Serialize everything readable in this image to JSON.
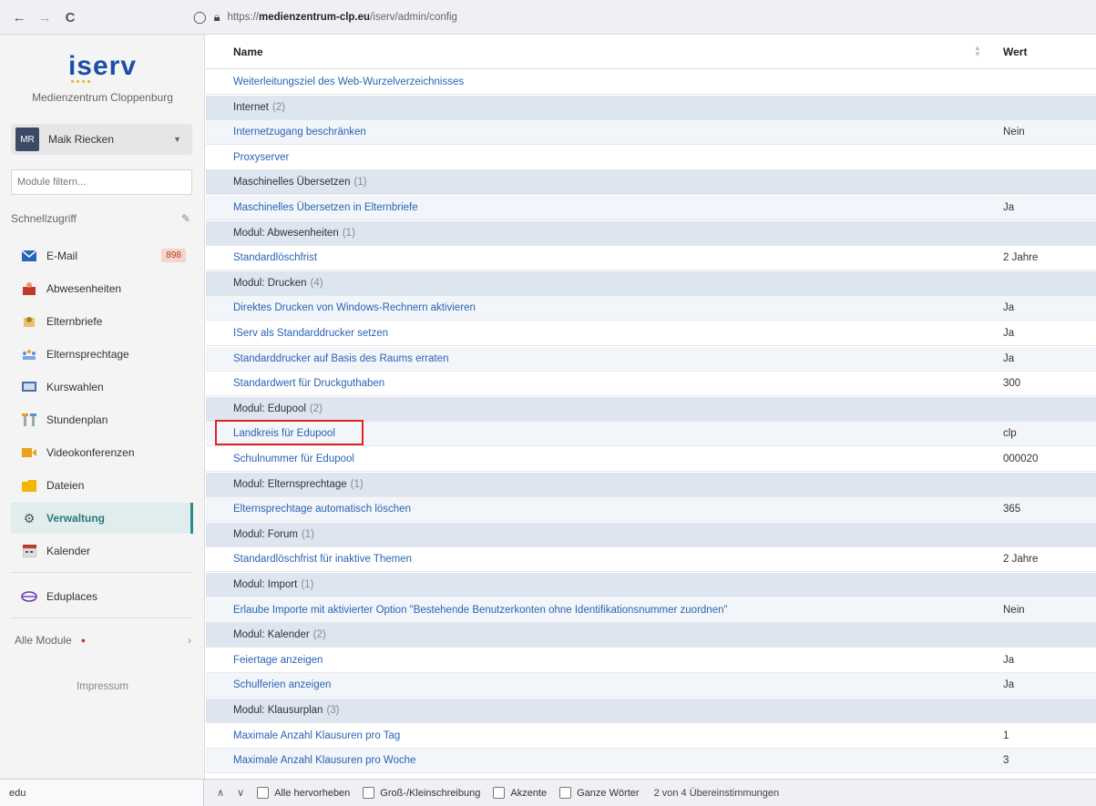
{
  "browser": {
    "back": "←",
    "forward": "→",
    "reload": "C",
    "url_prefix": "https://",
    "url_domain": "medienzentrum-clp.eu",
    "url_path": "/iserv/admin/config"
  },
  "sidebar": {
    "logo": "iserv",
    "school": "Medienzentrum Cloppenburg",
    "user": {
      "initials": "MR",
      "name": "Maik Riecken"
    },
    "filter_placeholder": "Module filtern...",
    "quick_access": "Schnellzugriff",
    "items": [
      {
        "label": "E-Mail",
        "badge": "898",
        "icon": "mail-icon"
      },
      {
        "label": "Abwesenheiten",
        "icon": "absence-icon"
      },
      {
        "label": "Elternbriefe",
        "icon": "letter-icon"
      },
      {
        "label": "Elternsprechtage",
        "icon": "people-icon"
      },
      {
        "label": "Kurswahlen",
        "icon": "course-icon"
      },
      {
        "label": "Stundenplan",
        "icon": "timetable-icon"
      },
      {
        "label": "Videokonferenzen",
        "icon": "video-icon"
      },
      {
        "label": "Dateien",
        "icon": "folder-icon"
      },
      {
        "label": "Verwaltung",
        "icon": "gear-icon",
        "active": true
      },
      {
        "label": "Kalender",
        "icon": "calendar-icon"
      }
    ],
    "eduplaces": "Eduplaces",
    "all_modules": "Alle Module",
    "impressum": "Impressum"
  },
  "table": {
    "header_name": "Name",
    "header_value": "Wert",
    "rows": [
      {
        "type": "item",
        "name": "Weiterleitungsziel des Web-Wurzelverzeichnisses",
        "value": ""
      },
      {
        "type": "group",
        "name": "Internet",
        "count": "(2)"
      },
      {
        "type": "item",
        "name": "Internetzugang beschränken",
        "value": "Nein"
      },
      {
        "type": "item",
        "name": "Proxyserver",
        "value": ""
      },
      {
        "type": "group",
        "name": "Maschinelles Übersetzen",
        "count": "(1)"
      },
      {
        "type": "item",
        "name": "Maschinelles Übersetzen in Elternbriefe",
        "value": "Ja"
      },
      {
        "type": "group",
        "name": "Modul: Abwesenheiten",
        "count": "(1)"
      },
      {
        "type": "item",
        "name": "Standardlöschfrist",
        "value": "2 Jahre"
      },
      {
        "type": "group",
        "name": "Modul: Drucken",
        "count": "(4)"
      },
      {
        "type": "item",
        "name": "Direktes Drucken von Windows-Rechnern aktivieren",
        "value": "Ja"
      },
      {
        "type": "item",
        "name": "IServ als Standarddrucker setzen",
        "value": "Ja"
      },
      {
        "type": "item",
        "name": "Standarddrucker auf Basis des Raums erraten",
        "value": "Ja"
      },
      {
        "type": "item",
        "name": "Standardwert für Druckguthaben",
        "value": "300"
      },
      {
        "type": "group",
        "name": "Modul: Edupool",
        "count": "(2)"
      },
      {
        "type": "item",
        "name": "Landkreis für Edupool",
        "value": "clp"
      },
      {
        "type": "item",
        "name": "Schulnummer für Edupool",
        "value": "000020"
      },
      {
        "type": "group",
        "name": "Modul: Elternsprechtage",
        "count": "(1)"
      },
      {
        "type": "item",
        "name": "Elternsprechtage automatisch löschen",
        "value": "365"
      },
      {
        "type": "group",
        "name": "Modul: Forum",
        "count": "(1)"
      },
      {
        "type": "item",
        "name": "Standardlöschfrist für inaktive Themen",
        "value": "2 Jahre"
      },
      {
        "type": "group",
        "name": "Modul: Import",
        "count": "(1)"
      },
      {
        "type": "item",
        "name": "Erlaube Importe mit aktivierter Option \"Bestehende Benutzerkonten ohne Identifikationsnummer zuordnen\"",
        "value": "Nein"
      },
      {
        "type": "group",
        "name": "Modul: Kalender",
        "count": "(2)"
      },
      {
        "type": "item",
        "name": "Feiertage anzeigen",
        "value": "Ja"
      },
      {
        "type": "item",
        "name": "Schulferien anzeigen",
        "value": "Ja"
      },
      {
        "type": "group",
        "name": "Modul: Klausurplan",
        "count": "(3)"
      },
      {
        "type": "item",
        "name": "Maximale Anzahl Klausuren pro Tag",
        "value": "1"
      },
      {
        "type": "item",
        "name": "Maximale Anzahl Klausuren pro Woche",
        "value": "3"
      }
    ]
  },
  "findbar": {
    "query": "edu",
    "prev": "∧",
    "next": "∨",
    "options": [
      "Alle hervorheben",
      "Groß-/Kleinschreibung",
      "Akzente",
      "Ganze Wörter"
    ],
    "status": "2 von 4 Übereinstimmungen"
  }
}
